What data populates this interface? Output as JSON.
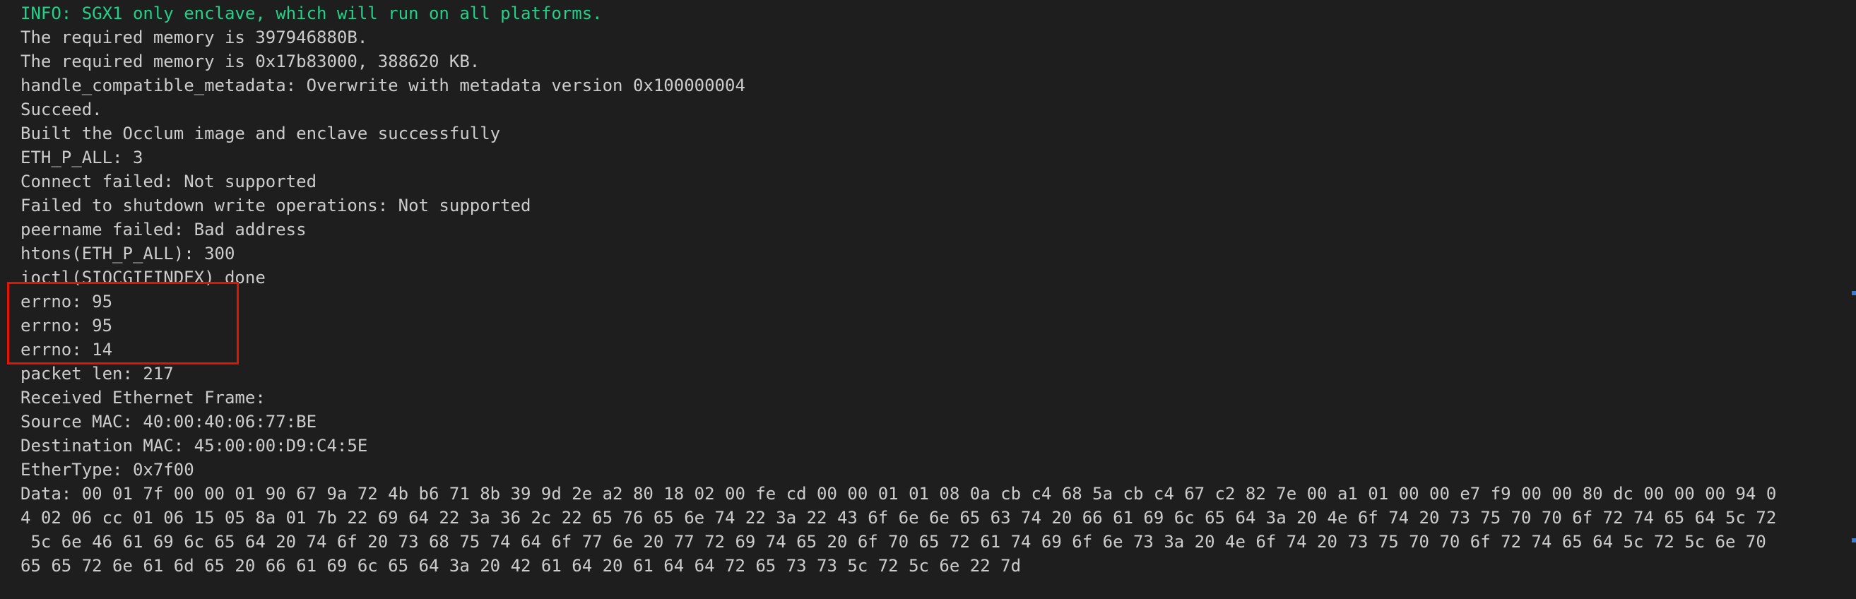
{
  "terminal": {
    "lines": [
      {
        "text": "INFO: SGX1 only enclave, which will run on all platforms.",
        "kind": "info"
      },
      {
        "text": "The required memory is 397946880B.",
        "kind": "normal"
      },
      {
        "text": "The required memory is 0x17b83000, 388620 KB.",
        "kind": "normal"
      },
      {
        "text": "handle_compatible_metadata: Overwrite with metadata version 0x100000004",
        "kind": "normal"
      },
      {
        "text": "Succeed.",
        "kind": "normal"
      },
      {
        "text": "Built the Occlum image and enclave successfully",
        "kind": "normal"
      },
      {
        "text": "ETH_P_ALL: 3",
        "kind": "normal"
      },
      {
        "text": "Connect failed: Not supported",
        "kind": "normal"
      },
      {
        "text": "Failed to shutdown write operations: Not supported",
        "kind": "normal"
      },
      {
        "text": "peername failed: Bad address",
        "kind": "normal"
      },
      {
        "text": "htons(ETH_P_ALL): 300",
        "kind": "normal"
      },
      {
        "text": "ioctl(SIOCGIFINDEX) done",
        "kind": "normal"
      },
      {
        "text": "errno: 95",
        "kind": "normal"
      },
      {
        "text": "errno: 95",
        "kind": "normal"
      },
      {
        "text": "errno: 14",
        "kind": "normal"
      },
      {
        "text": "packet len: 217",
        "kind": "normal"
      },
      {
        "text": "Received Ethernet Frame:",
        "kind": "normal"
      },
      {
        "text": "Source MAC: 40:00:40:06:77:BE",
        "kind": "normal"
      },
      {
        "text": "Destination MAC: 45:00:00:D9:C4:5E",
        "kind": "normal"
      },
      {
        "text": "EtherType: 0x7f00",
        "kind": "normal"
      },
      {
        "text": "Data: 00 01 7f 00 00 01 90 67 9a 72 4b b6 71 8b 39 9d 2e a2 80 18 02 00 fe cd 00 00 01 01 08 0a cb c4 68 5a cb c4 67 c2 82 7e 00 a1 01 00 00 e7 f9 00 00 80 dc 00 00 00 94 0",
        "kind": "normal"
      },
      {
        "text": "4 02 06 cc 01 06 15 05 8a 01 7b 22 69 64 22 3a 36 2c 22 65 76 65 6e 74 22 3a 22 43 6f 6e 6e 65 63 74 20 66 61 69 6c 65 64 3a 20 4e 6f 74 20 73 75 70 70 6f 72 74 65 64 5c 72",
        "kind": "normal"
      },
      {
        "text": " 5c 6e 46 61 69 6c 65 64 20 74 6f 20 73 68 75 74 64 6f 77 6e 20 77 72 69 74 65 20 6f 70 65 72 61 74 69 6f 6e 73 3a 20 4e 6f 74 20 73 75 70 70 6f 72 74 65 64 5c 72 5c 6e 70",
        "kind": "normal"
      },
      {
        "text": "65 65 72 6e 61 6d 65 20 66 61 69 6c 65 64 3a 20 42 61 64 20 61 64 64 72 65 73 73 5c 72 5c 6e 22 7d",
        "kind": "normal"
      }
    ]
  },
  "colors": {
    "background": "#1e1e1e",
    "text": "#cccccc",
    "info": "#23d18b",
    "highlight_border": "#e51400"
  }
}
